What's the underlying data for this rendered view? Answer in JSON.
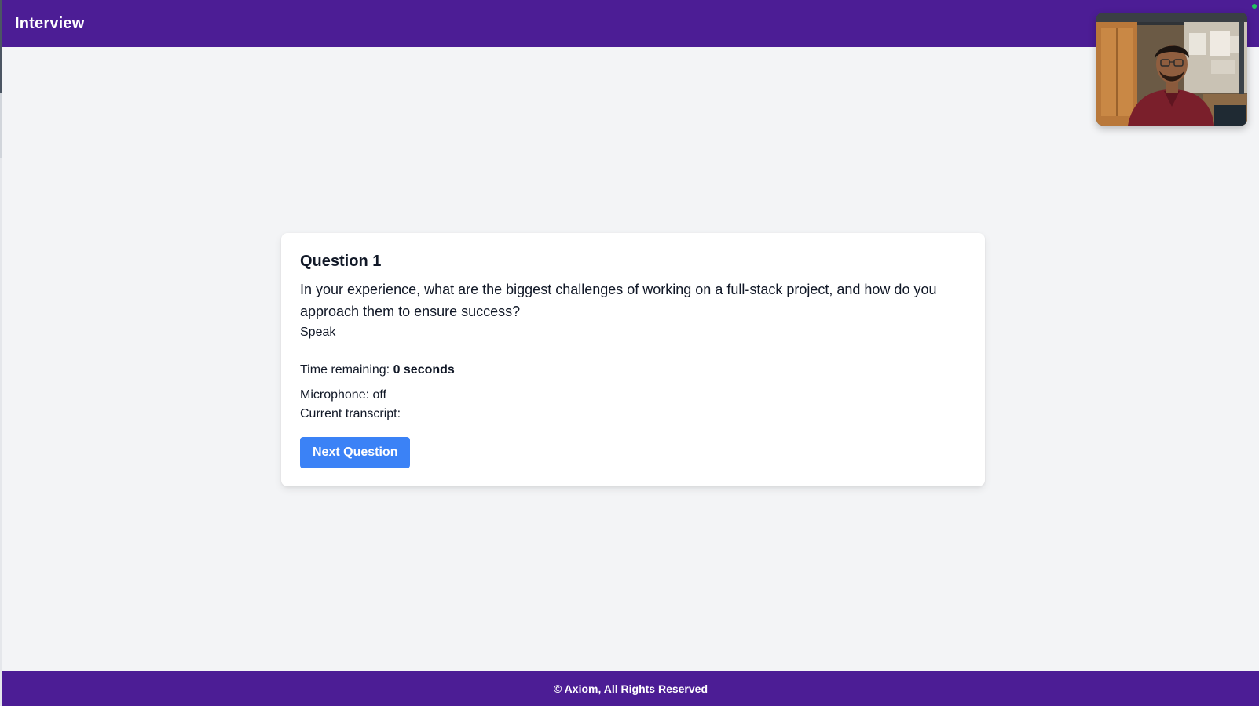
{
  "header": {
    "title": "Interview"
  },
  "webcam": {
    "icon": "webcam-preview"
  },
  "question": {
    "title": "Question 1",
    "text": "In your experience, what are the biggest challenges of working on a full-stack project, and how do you approach them to ensure success?",
    "speak_label": "Speak",
    "time_label": "Time remaining:",
    "time_value": "0 seconds",
    "microphone_status": "Microphone: off",
    "transcript_label": "Current transcript:",
    "next_button_label": "Next Question"
  },
  "footer": {
    "text": "© Axiom, All Rights Reserved"
  },
  "colors": {
    "brand": "#4c1d95",
    "button": "#3b82f6",
    "background": "#f3f4f6",
    "live_indicator": "#22c55e"
  }
}
